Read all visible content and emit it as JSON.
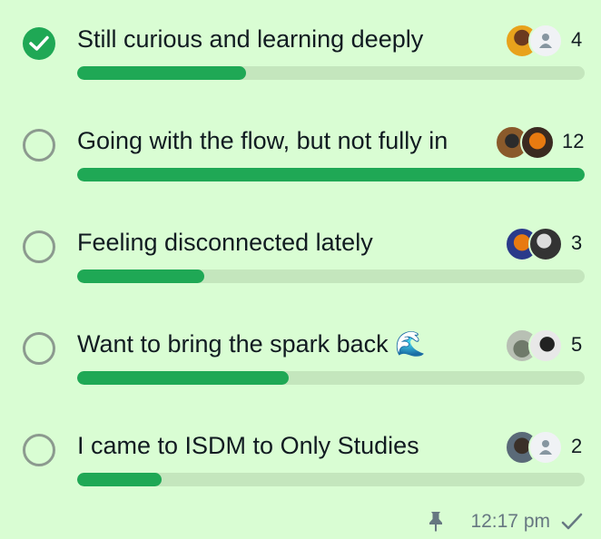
{
  "poll": {
    "options": [
      {
        "label": "Still curious and learning deeply",
        "votes": "4",
        "checked": true,
        "fill_percent": 33.3
      },
      {
        "label": "Going with the flow, but not fully in",
        "votes": "12",
        "checked": false,
        "fill_percent": 100
      },
      {
        "label": "Feeling disconnected lately",
        "votes": "3",
        "checked": false,
        "fill_percent": 25
      },
      {
        "label": "Want to bring the spark back",
        "emoji": "🌊",
        "votes": "5",
        "checked": false,
        "fill_percent": 41.7
      },
      {
        "label": "I came to ISDM to Only Studies",
        "votes": "2",
        "checked": false,
        "fill_percent": 16.7
      }
    ],
    "colors": {
      "bubble": "#d9fdd3",
      "accent": "#1fa855",
      "track": "#c4e6bd",
      "meta": "#667781"
    }
  },
  "footer": {
    "time": "12:17 pm",
    "pin_icon": "pin-icon",
    "status_icon": "single-check-icon"
  }
}
